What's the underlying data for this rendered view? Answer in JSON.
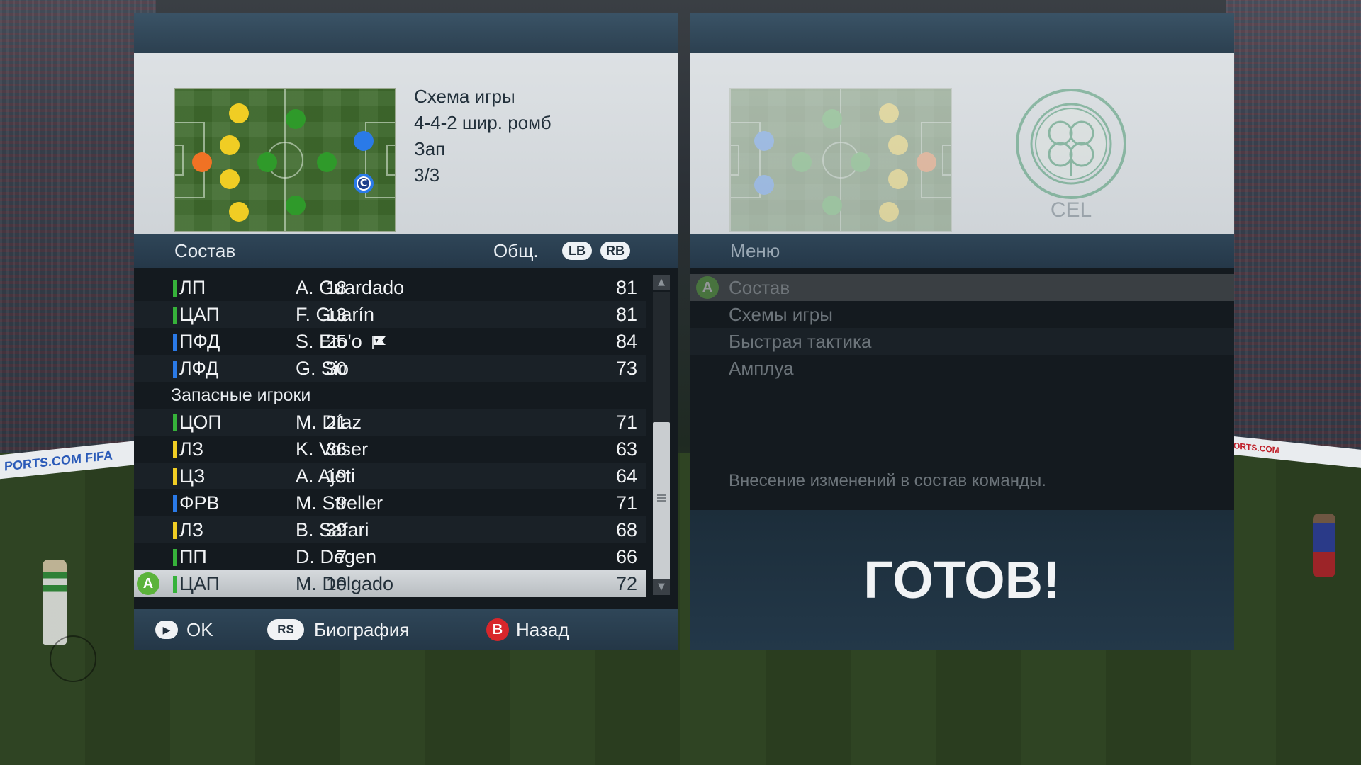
{
  "background": {
    "board_left": "PORTS.COM",
    "board_left_2": "FIFA",
    "board_right": "ORTS.COM"
  },
  "left_panel": {
    "formation": {
      "title": "Схема игры",
      "name": "4-4-2 шир. ромб",
      "mode": "Зап",
      "index": "3/3"
    },
    "roster_header": {
      "title": "Состав",
      "ovr_label": "Общ.",
      "lb": "LB",
      "rb": "RB"
    },
    "players": [
      {
        "pos": "ЛП",
        "num": "18",
        "name": "A. Guardado",
        "ovr": "81",
        "color": "#36b23a"
      },
      {
        "pos": "ЦАП",
        "num": "13",
        "name": "F. Guarín",
        "ovr": "81",
        "color": "#36b23a"
      },
      {
        "pos": "ПФД",
        "num": "25",
        "name": "S. Eto'o",
        "ovr": "84",
        "color": "#2a7ae8"
      },
      {
        "pos": "ЛФД",
        "num": "30",
        "name": "G. Sio",
        "ovr": "73",
        "color": "#2a7ae8"
      }
    ],
    "subs_label": "Запасные игроки",
    "subs": [
      {
        "pos": "ЦОП",
        "num": "21",
        "name": "M. Díaz",
        "ovr": "71",
        "color": "#36b23a"
      },
      {
        "pos": "ЛЗ",
        "num": "36",
        "name": "K. Voser",
        "ovr": "63",
        "color": "#f0cd24"
      },
      {
        "pos": "ЦЗ",
        "num": "19",
        "name": "A. Ajeti",
        "ovr": "64",
        "color": "#f0cd24"
      },
      {
        "pos": "ФРВ",
        "num": "9",
        "name": "M. Streller",
        "ovr": "71",
        "color": "#2a7ae8"
      },
      {
        "pos": "ЛЗ",
        "num": "39",
        "name": "B. Safari",
        "ovr": "68",
        "color": "#f0cd24"
      },
      {
        "pos": "ПП",
        "num": "7",
        "name": "D. Degen",
        "ovr": "66",
        "color": "#36b23a"
      },
      {
        "pos": "ЦАП",
        "num": "10",
        "name": "M. Delgado",
        "ovr": "72",
        "color": "#36b23a"
      }
    ],
    "a_button": "A",
    "captain_mark": "C",
    "footer": {
      "ok": "OK",
      "rs": "RS",
      "bio": "Биография",
      "b": "B",
      "back": "Назад"
    }
  },
  "right_panel": {
    "team_code": "CEL",
    "menu_title": "Меню",
    "a_button": "A",
    "menu": [
      "Состав",
      "Схемы игры",
      "Быстрая тактика",
      "Амплуа"
    ],
    "description": "Внесение изменений в состав команды.",
    "ready": "ГОТОВ!"
  }
}
